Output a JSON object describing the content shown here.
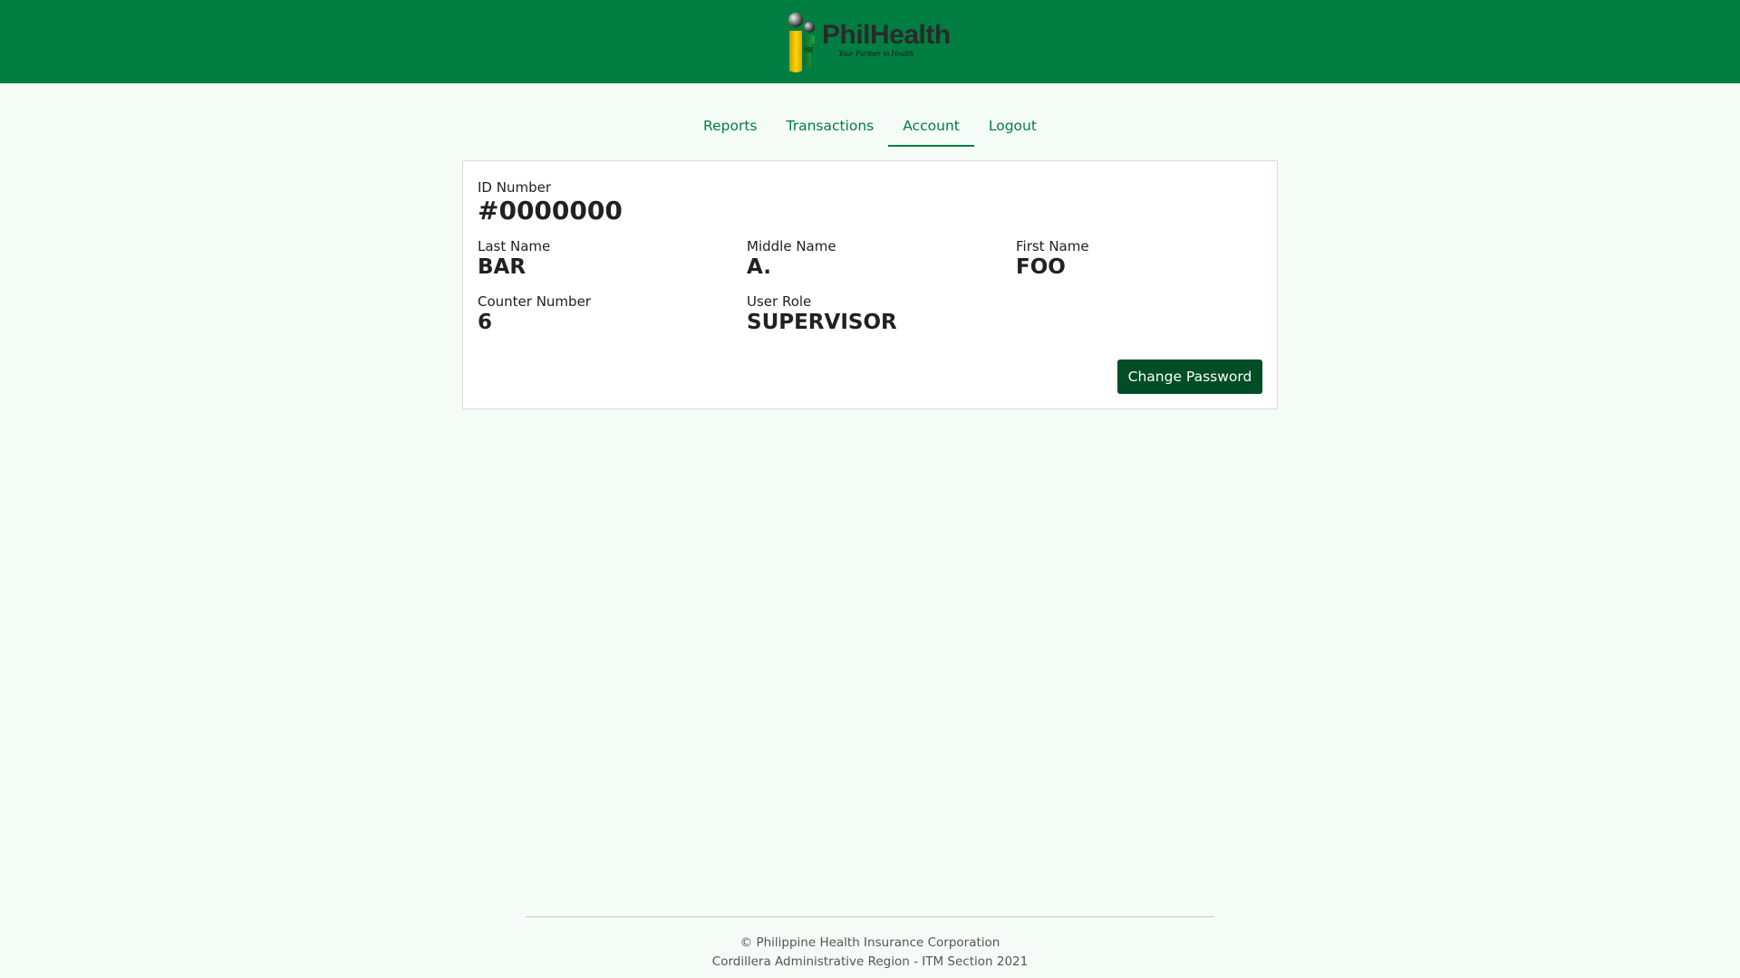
{
  "header": {
    "brand_name": "PhilHealth",
    "brand_tagline": "Your Partner in Health",
    "background_color": "#007e41"
  },
  "nav": {
    "items": [
      {
        "label": "Reports"
      },
      {
        "label": "Transactions"
      },
      {
        "label": "Account",
        "active": true
      },
      {
        "label": "Logout"
      }
    ],
    "accent_color": "#007e41"
  },
  "account": {
    "id_number_label": "ID Number",
    "id_number_value": "#0000000",
    "last_name_label": "Last Name",
    "last_name_value": "BAR",
    "middle_name_label": "Middle Name",
    "middle_name_value": "A.",
    "first_name_label": "First Name",
    "first_name_value": "FOO",
    "counter_number_label": "Counter Number",
    "counter_number_value": "6",
    "user_role_label": "User Role",
    "user_role_value": "SUPERVISOR",
    "change_password_label": "Change Password",
    "button_color": "#004d26"
  },
  "footer": {
    "line1": "© Philippine Health Insurance Corporation",
    "line2": "Cordillera Administrative Region - ITM Section 2021"
  }
}
